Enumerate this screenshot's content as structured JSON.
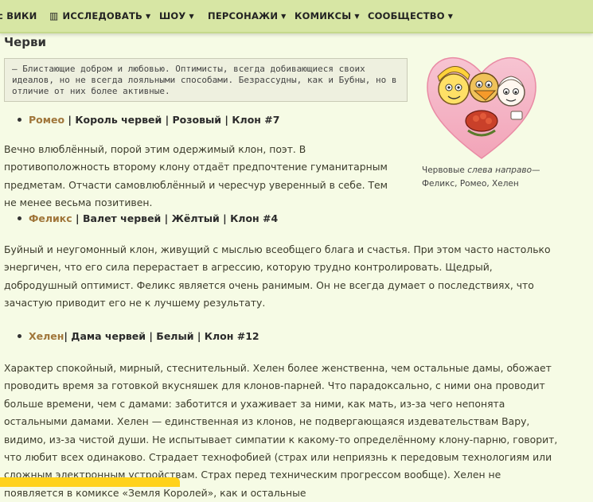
{
  "nav": {
    "items": [
      {
        "label": "ВИКИ",
        "prefix": "с"
      },
      {
        "label": "ИССЛЕДОВАТЬ"
      },
      {
        "label": "ШОУ"
      },
      {
        "label": "ПЕРСОНАЖИ"
      },
      {
        "label": "КОМИКСЫ"
      },
      {
        "label": "СООБЩЕСТВО"
      }
    ]
  },
  "page": {
    "section_title": "Черви",
    "quote": "— Блистающие добром и любовью. Оптимисты, всегда добивающиеся своих идеалов, но не всегда лояльными способами. Безрассудны, как и Бубны, но в отличие от них более активные.",
    "caption": {
      "before": "Червовые",
      "italic": "слева направо",
      "after": "— Феликс, Ромео, Хелен"
    },
    "characters": [
      {
        "name": "Ромео",
        "rest": "| Король червей | Розовый | Клон #7",
        "text": "Вечно влюблённый, порой этим одержимый клон, поэт. В противоположность второму клону отдаёт предпочтение гуманитарным предметам. Отчасти самовлюблённый и чересчур уверенный в себе. Тем не менее весьма позитивен."
      },
      {
        "name": "Феликс",
        "rest": " | Валет червей | Жёлтый | Клон #4",
        "text": "Буйный и неугомонный клон, живущий с мыслью всеобщего блага и счастья. При этом часто настолько энергичен, что его сила перерастает в агрессию, которую трудно контролировать. Щедрый, добродушный оптимист. Феликс является очень ранимым. Он не всегда думает о последствиях, что зачастую приводит его не к лучшему результату."
      },
      {
        "name": "Хелен",
        "rest": "| Дама червей | Белый | Клон #12",
        "text": "Характер спокойный, мирный, стеснительный. Хелен более женственна, чем остальные дамы, обожает проводить время за готовкой вкусняшек для клонов-парней. Что парадоксально, с ними она проводит больше времени, чем с дамами: заботится и ухаживает за ними, как мать, из-за чего непонята остальными дамами. Хелен — единственная из клонов, не подвергающаяся издевательствам Вару, видимо, из-за чистой души. Не испытывает симпатии к какому-то определённому клону-парню, говорит, что любит всех одинаково. Страдает технофобией (страх или неприязнь к передовым технологиям или сложным электронным устройствам. Страх перед техническим прогрессом вообще). Хелен не появляется в комиксе «Земля Королей», как и остальные"
      }
    ]
  }
}
